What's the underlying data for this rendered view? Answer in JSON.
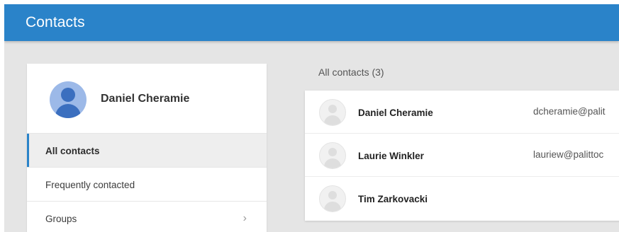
{
  "header": {
    "title": "Contacts",
    "color": "#2a83c9"
  },
  "sidebar": {
    "profile": {
      "name": "Daniel Cheramie",
      "avatar_icon": "user-avatar-icon",
      "avatar_color": "#3b6fbf"
    },
    "items": [
      {
        "label": "All contacts",
        "active": true
      },
      {
        "label": "Frequently contacted",
        "active": false
      },
      {
        "label": "Groups",
        "active": false,
        "icon": "chevron-right-icon"
      }
    ],
    "chevron_glyph": "›"
  },
  "main": {
    "heading": "All contacts (3)",
    "contacts": [
      {
        "name": "Daniel Cheramie",
        "email": "dcheramie@palit"
      },
      {
        "name": "Laurie Winkler",
        "email": "lauriew@palittoc"
      },
      {
        "name": "Tim Zarkovacki",
        "email": ""
      }
    ],
    "placeholder_avatar_icon": "person-placeholder-icon"
  }
}
